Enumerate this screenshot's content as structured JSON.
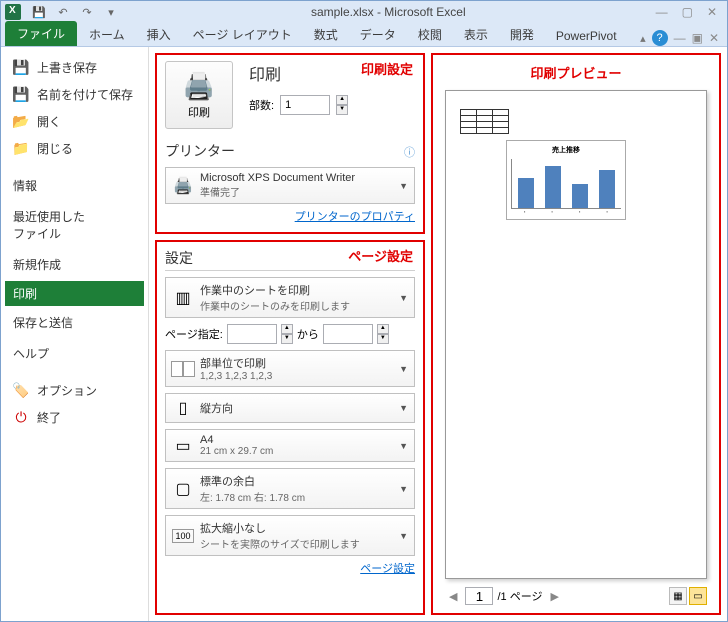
{
  "title": "sample.xlsx - Microsoft Excel",
  "qat": {
    "save": "💾",
    "undo": "↶",
    "redo": "↷"
  },
  "win": {
    "min": "—",
    "max": "▢",
    "close": "✕"
  },
  "tabs": [
    "ファイル",
    "ホーム",
    "挿入",
    "ページ レイアウト",
    "数式",
    "データ",
    "校閲",
    "表示",
    "開発",
    "PowerPivot"
  ],
  "sidebar": {
    "save": "上書き保存",
    "saveas": "名前を付けて保存",
    "open": "開く",
    "close": "閉じる",
    "info": "情報",
    "recent": "最近使用した\nファイル",
    "new": "新規作成",
    "print": "印刷",
    "share": "保存と送信",
    "help": "ヘルプ",
    "options": "オプション",
    "exit": "終了"
  },
  "print": {
    "annot1": "印刷設定",
    "header": "印刷",
    "big_label": "印刷",
    "copies_label": "部数:",
    "copies_value": "1",
    "printer_header": "プリンター",
    "printer_name": "Microsoft XPS Document Writer",
    "printer_status": "準備完了",
    "printer_props": "プリンターのプロパティ"
  },
  "settings": {
    "annot2": "ページ設定",
    "header": "設定",
    "scope_title": "作業中のシートを印刷",
    "scope_sub": "作業中のシートのみを印刷します",
    "page_label": "ページ指定:",
    "page_to": "から",
    "collate_title": "部単位で印刷",
    "collate_sub": "1,2,3   1,2,3   1,2,3",
    "orient_title": "縦方向",
    "paper_title": "A4",
    "paper_sub": "21 cm x 29.7 cm",
    "margin_title": "標準の余白",
    "margin_sub": "左: 1.78 cm   右: 1.78 cm",
    "scale_title": "拡大縮小なし",
    "scale_sub": "シートを実際のサイズで印刷します",
    "page_setup_link": "ページ設定"
  },
  "preview": {
    "title": "印刷プレビュー",
    "chart_title": "売上推移",
    "page_current": "1",
    "page_total": "/1 ページ"
  },
  "chart_data": {
    "type": "bar",
    "title": "売上推移",
    "categories": [
      "",
      "",
      "",
      ""
    ],
    "values": [
      30,
      42,
      24,
      38
    ]
  }
}
